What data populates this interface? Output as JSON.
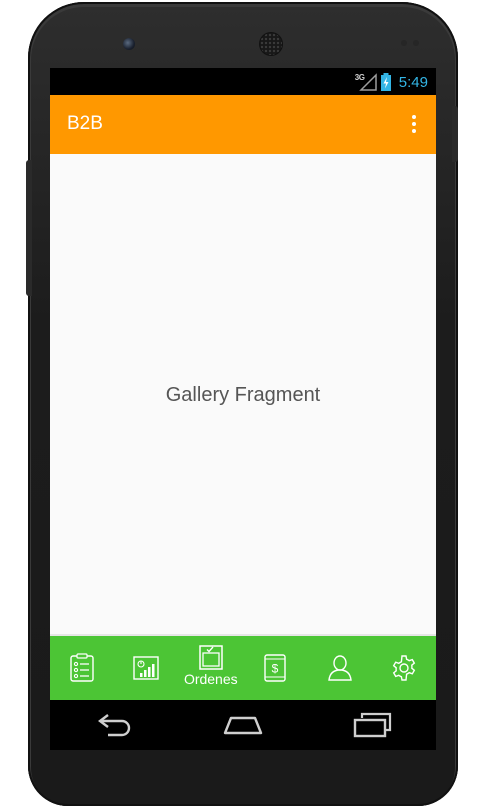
{
  "status_bar": {
    "network_type": "3G",
    "time": "5:49"
  },
  "app_bar": {
    "title": "B2B",
    "overflow_icon": "more-vert-icon"
  },
  "content": {
    "text": "Gallery Fragment"
  },
  "bottom_nav": {
    "tabs": [
      {
        "icon": "checklist-icon",
        "label": ""
      },
      {
        "icon": "bar-chart-icon",
        "label": ""
      },
      {
        "icon": "clipboard-check-icon",
        "label": "Ordenes",
        "active": true
      },
      {
        "icon": "dollar-tablet-icon",
        "label": ""
      },
      {
        "icon": "person-icon",
        "label": ""
      },
      {
        "icon": "gear-icon",
        "label": ""
      }
    ]
  },
  "system_nav": {
    "buttons": [
      "back-icon",
      "home-icon",
      "recents-icon"
    ]
  },
  "colors": {
    "app_bar": "#ff9800",
    "bottom_nav": "#4cc535",
    "status_time": "#33b5e5",
    "content_bg": "#fafafa"
  }
}
